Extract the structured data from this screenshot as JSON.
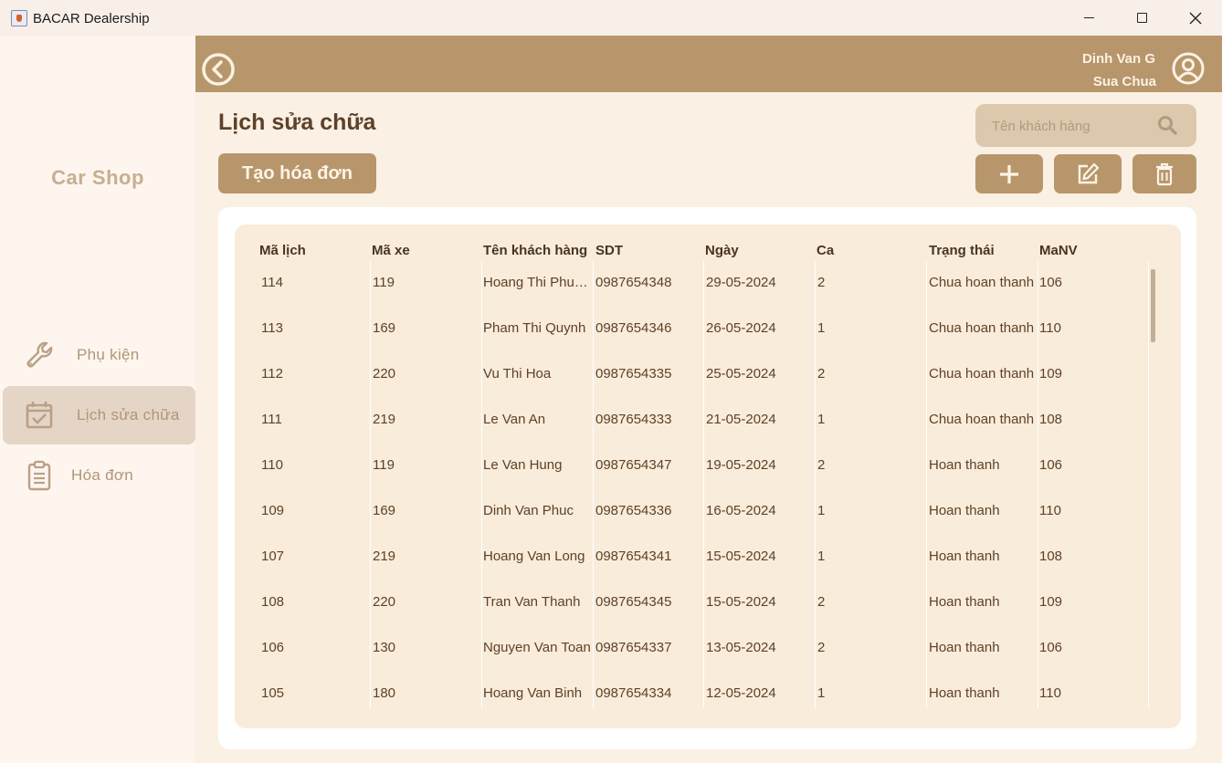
{
  "window": {
    "title": "BACAR Dealership"
  },
  "sidebar": {
    "brand": "Car Shop",
    "items": [
      {
        "label": "Phụ kiện",
        "icon": "wrench-icon",
        "active": false
      },
      {
        "label": "Lịch sửa chữa",
        "icon": "calendar-check-icon",
        "active": true
      },
      {
        "label": "Hóa đơn",
        "icon": "clipboard-icon",
        "active": false
      }
    ]
  },
  "header": {
    "user_name": "Dinh Van G",
    "user_role": "Sua Chua"
  },
  "main": {
    "title": "Lịch sửa chữa",
    "search_placeholder": "Tên khách hàng",
    "create_label": "Tạo hóa đơn"
  },
  "table": {
    "columns": [
      "Mã lịch",
      "Mã xe",
      "Tên khách hàng",
      "SDT",
      "Ngày",
      "Ca",
      "Trạng thái",
      "MaNV"
    ],
    "rows": [
      [
        "114",
        "119",
        "Hoang Thi Phuon...",
        "0987654348",
        "29-05-2024",
        "2",
        "Chua hoan thanh",
        "106"
      ],
      [
        "113",
        "169",
        "Pham Thi Quynh",
        "0987654346",
        "26-05-2024",
        "1",
        "Chua hoan thanh",
        "110"
      ],
      [
        "112",
        "220",
        "Vu Thi Hoa",
        "0987654335",
        "25-05-2024",
        "2",
        "Chua hoan thanh",
        "109"
      ],
      [
        "111",
        "219",
        "Le Van An",
        "0987654333",
        "21-05-2024",
        "1",
        "Chua hoan thanh",
        "108"
      ],
      [
        "110",
        "119",
        "Le Van Hung",
        "0987654347",
        "19-05-2024",
        "2",
        "Hoan thanh",
        "106"
      ],
      [
        "109",
        "169",
        "Dinh Van Phuc",
        "0987654336",
        "16-05-2024",
        "1",
        "Hoan thanh",
        "110"
      ],
      [
        "107",
        "219",
        "Hoang Van Long",
        "0987654341",
        "15-05-2024",
        "1",
        "Hoan thanh",
        "108"
      ],
      [
        "108",
        "220",
        "Tran Van Thanh",
        "0987654345",
        "15-05-2024",
        "2",
        "Hoan thanh",
        "109"
      ],
      [
        "106",
        "130",
        "Nguyen Van Toan",
        "0987654337",
        "13-05-2024",
        "2",
        "Hoan thanh",
        "106"
      ],
      [
        "105",
        "180",
        "Hoang Van Binh",
        "0987654334",
        "12-05-2024",
        "1",
        "Hoan thanh",
        "110"
      ]
    ]
  },
  "colors": {
    "accent": "#b8966c",
    "background": "#faf0e4",
    "text": "#5e4128"
  }
}
